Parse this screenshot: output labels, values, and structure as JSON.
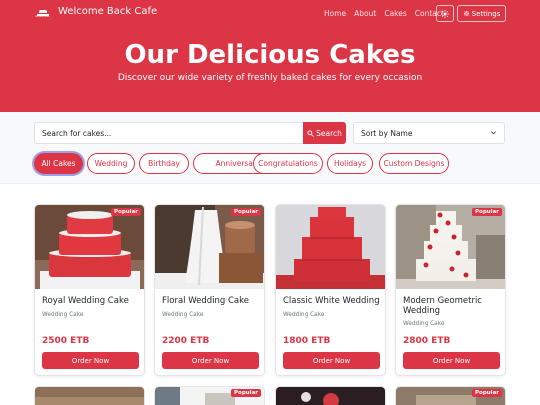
{
  "navbar": {
    "brand": "Welcome Back Cafe",
    "logo_text": "Welcome Back",
    "links": [
      "Home",
      "About",
      "Cakes",
      "Contact"
    ],
    "theme_icon": "sun-icon",
    "settings_label": "Settings"
  },
  "hero": {
    "title": "Our Delicious Cakes",
    "subtitle": "Discover our wide variety of freshly baked cakes for every occasion"
  },
  "search": {
    "placeholder": "Search for cakes...",
    "button_label": "Search",
    "sort_value": "Sort by Name"
  },
  "filters": [
    "All Cakes",
    "Wedding",
    "Birthday",
    "Anniversary",
    "Congratulations",
    "Holidays",
    "Custom Designs"
  ],
  "active_filter": "All Cakes",
  "cards": [
    {
      "badge": "Popular",
      "title": "Royal Wedding Cake",
      "category": "Wedding Cake",
      "price": "2500 ETB",
      "button": "Order Now"
    },
    {
      "badge": "Popular",
      "title": "Floral Wedding Cake",
      "category": "Wedding Cake",
      "price": "2200 ETB",
      "button": "Order Now"
    },
    {
      "badge": "Popular",
      "title": "Classic White Wedding",
      "category": "Wedding Cake",
      "price": "1800 ETB",
      "button": "Order Now"
    },
    {
      "badge": "Popular",
      "title": "Modern Geometric Wedding",
      "category": "Wedding Cake",
      "price": "2800 ETB",
      "button": "Order Now"
    }
  ],
  "second_row": [
    {
      "badge": ""
    },
    {
      "badge": "Popular"
    },
    {
      "badge": ""
    },
    {
      "badge": "Popular"
    }
  ],
  "colors": {
    "primary": "#dc3545",
    "text": "#212529",
    "muted": "#6c757d"
  }
}
